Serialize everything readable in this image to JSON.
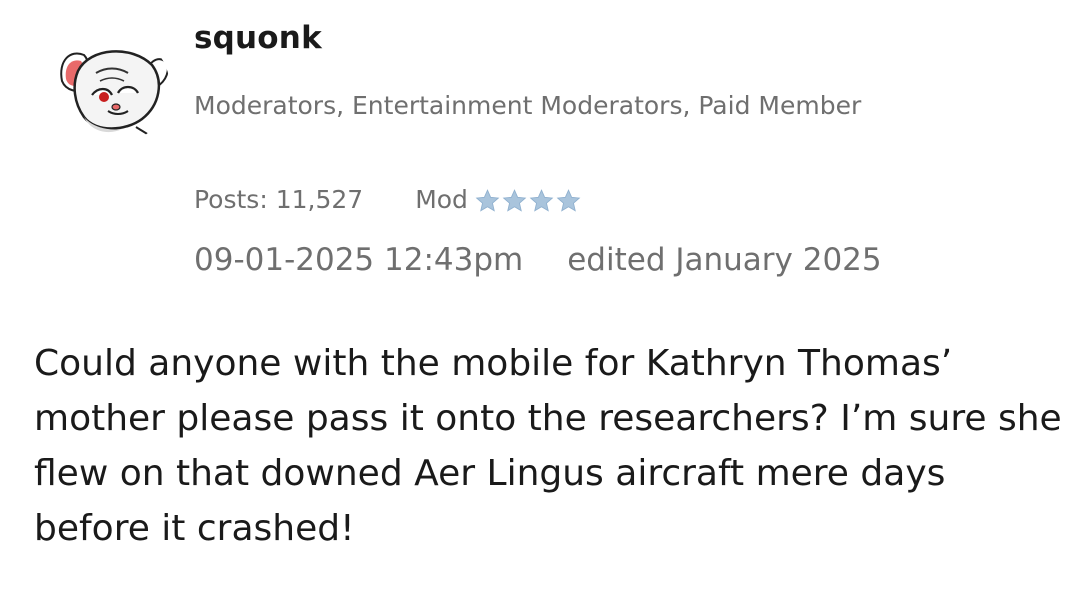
{
  "post": {
    "author": {
      "username": "squonk",
      "avatar_icon": "cartoon-mouse-avatar-icon",
      "roles": "Moderators, Entertainment Moderators, Paid Member",
      "posts": "Posts: 11,527",
      "rank": "Mod",
      "rank_stars": 4,
      "star_color": "#a9c4dc"
    },
    "date": "09-01-2025 12:43pm",
    "edited": "edited January 2025",
    "body": "Could anyone with the mobile for Kathryn Thomas’ mother please pass it onto the researchers? I’m sure she flew on that downed Aer Lingus aircraft mere days before it crashed!"
  }
}
